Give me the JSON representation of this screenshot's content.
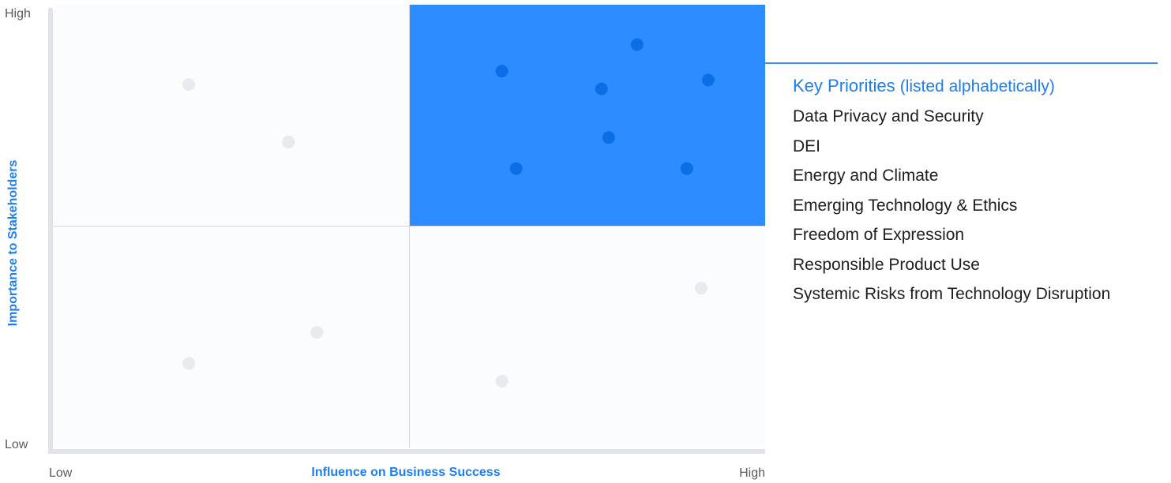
{
  "colors": {
    "plot_bg": "#fbfcfd",
    "highlight_quadrant": "#2d8cff",
    "highlight_point": "#0a6fe6",
    "muted_point": "#e9eaef",
    "axis_bar": "#e2e3e8",
    "divider": "#d5d6db",
    "accent_text": "#1b7ff0",
    "tick_text": "#5a5a5a",
    "rule": "#3a8fe8"
  },
  "legend": {
    "title_strong": "Key Priorities",
    "title_note": "(listed alphabetically)",
    "items": [
      "Data Privacy and Security",
      "DEI",
      "Energy and Climate",
      "Emerging Technology & Ethics",
      "Freedom of Expression",
      "Responsible Product Use",
      "Systemic Risks from Technology Disruption"
    ]
  },
  "chart_data": {
    "type": "scatter",
    "title": "",
    "xlabel": "Influence on Business Success",
    "ylabel": "Importance to Stakeholders",
    "x_ticks": [
      "Low",
      "High"
    ],
    "y_ticks": [
      "Low",
      "High"
    ],
    "xlim": [
      0,
      1
    ],
    "ylim": [
      0,
      1
    ],
    "quadrant_split": {
      "x": 0.5,
      "y": 0.5
    },
    "highlighted_quadrant": "top-right",
    "grid": false,
    "legend_position": "right",
    "series": [
      {
        "name": "Key Priorities",
        "points": [
          {
            "x": 0.63,
            "y": 0.85
          },
          {
            "x": 0.82,
            "y": 0.91
          },
          {
            "x": 0.92,
            "y": 0.83
          },
          {
            "x": 0.77,
            "y": 0.81
          },
          {
            "x": 0.78,
            "y": 0.7
          },
          {
            "x": 0.65,
            "y": 0.63
          },
          {
            "x": 0.89,
            "y": 0.63
          }
        ]
      },
      {
        "name": "",
        "points": [
          {
            "x": 0.19,
            "y": 0.82
          },
          {
            "x": 0.33,
            "y": 0.69
          },
          {
            "x": 0.91,
            "y": 0.36
          },
          {
            "x": 0.37,
            "y": 0.26
          },
          {
            "x": 0.19,
            "y": 0.19
          },
          {
            "x": 0.63,
            "y": 0.15
          }
        ]
      }
    ]
  }
}
